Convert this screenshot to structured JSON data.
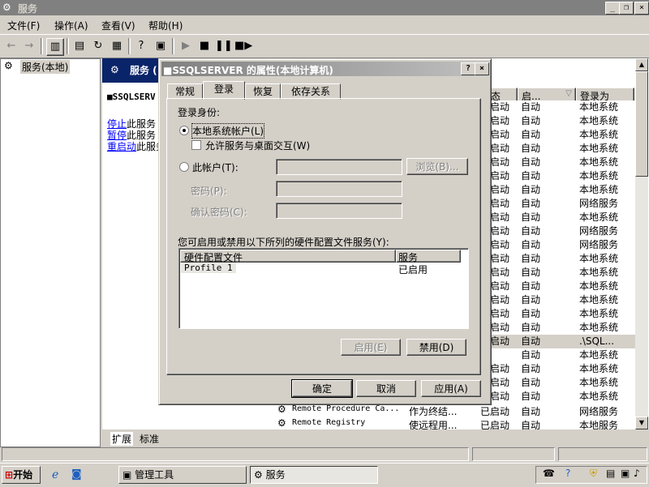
{
  "window": {
    "title": "服务"
  },
  "menu": [
    "文件(F)",
    "操作(A)",
    "查看(V)",
    "帮助(H)"
  ],
  "tree": {
    "root": "服务(本地)"
  },
  "detail": {
    "header": "服务 (",
    "service_name": "■SSQLSERV",
    "actions": [
      {
        "link": "停止",
        "rest": "此服务"
      },
      {
        "link": "暂停",
        "rest": "此服务"
      },
      {
        "link": "重启动",
        "rest": "此服务"
      }
    ]
  },
  "list": {
    "columns": {
      "status": "态",
      "startup": "启...",
      "logon": "登录为"
    },
    "rows": [
      [
        "启动",
        "自动",
        "本地系统"
      ],
      [
        "启动",
        "自动",
        "本地系统"
      ],
      [
        "启动",
        "自动",
        "本地系统"
      ],
      [
        "启动",
        "自动",
        "本地系统"
      ],
      [
        "启动",
        "自动",
        "本地系统"
      ],
      [
        "启动",
        "自动",
        "本地系统"
      ],
      [
        "启动",
        "自动",
        "本地系统"
      ],
      [
        "启动",
        "自动",
        "网络服务"
      ],
      [
        "启动",
        "自动",
        "本地系统"
      ],
      [
        "启动",
        "自动",
        "网络服务"
      ],
      [
        "启动",
        "自动",
        "网络服务"
      ],
      [
        "启动",
        "自动",
        "本地系统"
      ],
      [
        "启动",
        "自动",
        "本地系统"
      ],
      [
        "启动",
        "自动",
        "本地系统"
      ],
      [
        "启动",
        "自动",
        "本地系统"
      ],
      [
        "启动",
        "自动",
        "本地系统"
      ],
      [
        "启动",
        "自动",
        "本地系统"
      ],
      [
        "启动",
        "自动",
        ".\\SQL..."
      ],
      [
        "",
        "自动",
        "本地系统"
      ],
      [
        "启动",
        "自动",
        "本地系统"
      ],
      [
        "启动",
        "自动",
        "本地系统"
      ],
      [
        "启动",
        "自动",
        "本地系统"
      ]
    ],
    "bottom_rows": [
      {
        "name": "Remote Procedure Ca...",
        "desc": "作为终结...",
        "status": "已启动",
        "startup": "自动",
        "logon": "网络服务"
      },
      {
        "name": "Remote Registry",
        "desc": "使远程用...",
        "status": "已启动",
        "startup": "自动",
        "logon": "本地服务"
      }
    ]
  },
  "bottom_tabs": [
    "扩展",
    "标准"
  ],
  "dialog": {
    "title": "■SSQLSERVER 的属性(本地计算机)",
    "help_btn": "?",
    "close_btn": "×",
    "tabs": [
      "常规",
      "登录",
      "恢复",
      "依存关系"
    ],
    "logon_as_label": "登录身份:",
    "local_system": "本地系统帐户(L)",
    "allow_desktop": "允许服务与桌面交互(W)",
    "this_account": "此帐户(T):",
    "browse": "浏览(B)...",
    "password": "密码(P):",
    "confirm_password": "确认密码(C):",
    "hw_label": "您可启用或禁用以下所列的硬件配置文件服务(Y):",
    "hw_columns": [
      "硬件配置文件",
      "服务"
    ],
    "hw_rows": [
      {
        "profile": "Profile 1",
        "service": "已启用"
      }
    ],
    "enable": "启用(E)",
    "disable": "禁用(D)",
    "ok": "确定",
    "cancel": "取消",
    "apply": "应用(A)"
  },
  "taskbar": {
    "start": "开始",
    "tasks": [
      "管理工具",
      "服务"
    ]
  }
}
